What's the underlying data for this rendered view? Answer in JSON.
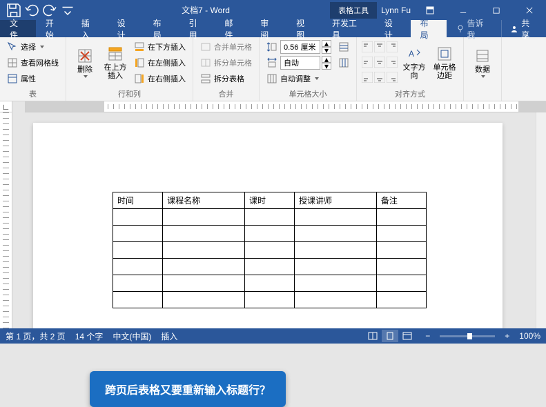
{
  "titlebar": {
    "doc_title": "文档7 - Word",
    "tools_context": "表格工具",
    "user": "Lynn Fu"
  },
  "tabs": {
    "file": "文件",
    "home": "开始",
    "insert": "插入",
    "design": "设计",
    "layout": "布局",
    "references": "引用",
    "mail": "邮件",
    "review": "审阅",
    "view": "视图",
    "developer": "开发工具",
    "tbl_design": "设计",
    "tbl_layout": "布局",
    "tellme": "告诉我",
    "share": "共享"
  },
  "ribbon": {
    "g_table": {
      "label": "表",
      "select": "选择",
      "gridlines": "查看网格线",
      "properties": "属性"
    },
    "g_rowcol": {
      "label": "行和列",
      "delete": "删除",
      "above": "在上方插入",
      "below": "在下方插入",
      "left": "在左侧插入",
      "right": "在右侧插入"
    },
    "g_merge": {
      "label": "合并",
      "merge": "合并单元格",
      "split_cell": "拆分单元格",
      "split_tbl": "拆分表格"
    },
    "g_size": {
      "label": "单元格大小",
      "height_val": "0.56 厘米",
      "autofit": "自动",
      "autofit_adjust": "自动调整"
    },
    "g_align": {
      "label": "对齐方式",
      "text_dir": "文字方向",
      "margins": "单元格边距"
    },
    "g_data": {
      "label": "",
      "data": "数据"
    }
  },
  "table": {
    "headers": [
      "时间",
      "课程名称",
      "课时",
      "授课讲师",
      "备注"
    ],
    "rows": [
      [
        "",
        "",
        "",
        "",
        ""
      ],
      [
        "",
        "",
        "",
        "",
        ""
      ],
      [
        "",
        "",
        "",
        "",
        ""
      ],
      [
        "",
        "",
        "",
        "",
        ""
      ],
      [
        "",
        "",
        "",
        "",
        ""
      ],
      [
        "",
        "",
        "",
        "",
        ""
      ]
    ]
  },
  "callout": "跨页后表格又要重新输入标题行？",
  "status": {
    "page": "第 1 页，共 2 页",
    "words": "14 个字",
    "lang": "中文(中国)",
    "mode": "插入",
    "zoom": "100%"
  }
}
